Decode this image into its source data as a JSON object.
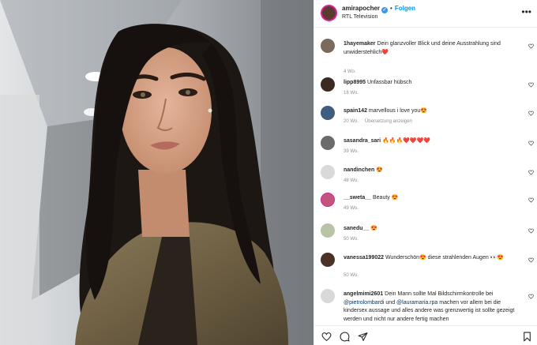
{
  "post": {
    "username": "amirapocher",
    "follow_label": "Folgen",
    "subtitle": "RTL Television",
    "more_icon": "more-icon"
  },
  "comments": [
    {
      "user": "1hayemaker",
      "text": "Dein glanzvoller Blick und deine Ausstrahlung sind unwiderstehlich❤️",
      "age": "4 Wo.",
      "reply": "",
      "avatar": "#7a6a5c"
    },
    {
      "user": "lipp8995",
      "text": "Unfassbar hübsch",
      "age": "18 Wo.",
      "reply": "",
      "avatar": "#3b2a22"
    },
    {
      "user": "spain142",
      "text": "marvellous i love you😍",
      "age": "20 Wo.",
      "reply": "Übersetzung anzeigen",
      "avatar": "#3f5d80"
    },
    {
      "user": "sasandra_sari",
      "text": "🔥🔥🔥❤️❤️❤️❤️",
      "age": "39 Wo.",
      "reply": "",
      "avatar": "#6b6b6b"
    },
    {
      "user": "nandinchen",
      "text": "😍",
      "age": "48 Wo.",
      "reply": "",
      "avatar": "#d9d9d9"
    },
    {
      "user": "__sweta__",
      "text": "Beauty 😍",
      "age": "49 Wo.",
      "reply": "",
      "avatar": "#c1567a"
    },
    {
      "user": "sanedu__",
      "text": "😍",
      "age": "50 Wo.",
      "reply": "",
      "avatar": "#b8c4a8"
    },
    {
      "user": "vanessa199022",
      "text": "Wunderschön😍 diese strahlenden Augen 👀😍",
      "age": "50 Wo.",
      "reply": "",
      "avatar": "#4a3326"
    },
    {
      "user": "angelmimi2601",
      "text_parts": [
        "Dein Mann sollte Mal Bildschirmkontrolle bei ",
        "@pietrolombardi",
        " und ",
        "@lauramaria.rpa",
        " machen vor allem bei die kindersex aussage und alles andere was grenzwertig ist sollte gezeigt werden und nicht nur andere fertig machen"
      ],
      "age": "",
      "reply": "",
      "avatar": "#d9d9d9"
    }
  ],
  "actions": {
    "like": "heart-icon",
    "comment": "comment-icon",
    "share": "share-icon",
    "save": "bookmark-icon"
  },
  "colors": {
    "follow": "#0095f6",
    "mention": "#00376b",
    "meta": "#8e8e8e"
  }
}
